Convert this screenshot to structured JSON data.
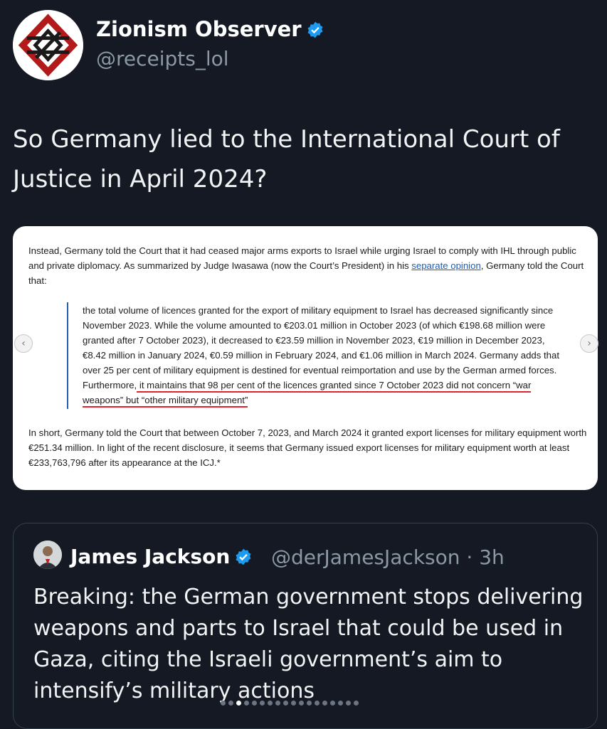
{
  "author": {
    "display_name": "Zionism Observer",
    "handle": "@receipts_lol",
    "verified": true,
    "avatar_icon": "red-diamond-logo-icon"
  },
  "tweet_text": "So Germany lied to the International Court of Justice in April 2024?",
  "document": {
    "p1_before_link": "Instead, Germany told the Court that it had ceased major arms exports to Israel while urging Israel to comply with IHL through public and private diplomacy. As summarized by Judge Iwasawa (now the Court’s President) in his ",
    "p1_link": "separate opinion",
    "p1_after_link": ", Germany told the Court that:",
    "quote_before_highlight": "the total volume of licences granted for the export of military equipment to Israel has decreased significantly since November 2023. While the volume amounted to €203.01 million in October 2023 (of which €198.68 million were granted after 7 October 2023), it decreased to €23.59 million in November 2023, €19 million in December 2023, €8.42 million in January 2024, €0.59 million in February 2024, and €1.06 million in March 2024. Germany adds that over 25 per cent of military equipment is destined for eventual reimportation and use by the German armed forces. Furthermore,",
    "quote_highlight": " it maintains that 98 per cent of the licences granted since 7 October 2023 did not concern “war weapons” but “other military equipment”",
    "p2": "In short, Germany told the Court that between October 7, 2023, and March 2024 it granted export licenses for military equipment worth €251.34 million. In light of the recent disclosure, it seems that Germany issued export licenses for military equipment worth at least €233,763,796 after its appearance at the ICJ.*",
    "highlight_color": "#e0242f",
    "link_color": "#1f5db4"
  },
  "carousel": {
    "prev_icon": "‹",
    "next_icon": "›",
    "total_dots": 18,
    "active_dot": 3
  },
  "quoted_tweet": {
    "display_name": "James Jackson",
    "handle_time": "@derJamesJackson · 3h",
    "verified": true,
    "text": "Breaking: the German government stops delivering weapons and parts to Israel that could be used in Gaza, citing the Israeli government’s aim to intensify’s military actions"
  },
  "colors": {
    "background": "#141923",
    "verified_blue": "#1d9bf0",
    "muted_text": "#8b98a5"
  }
}
